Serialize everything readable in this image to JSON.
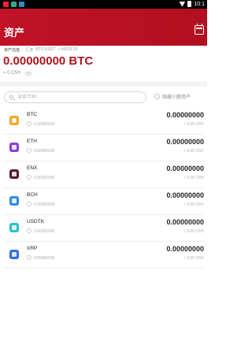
{
  "statusbar": {
    "time": "10:1"
  },
  "header": {
    "title": "资产"
  },
  "overview": {
    "valuation_label": "资产估值",
    "exchange_label": "汇率",
    "pair_label": "BTC/USDT",
    "pair_price": "≈ 44229.23",
    "total": "0.00000000 BTC",
    "total_cny": "≈ 0 CNY"
  },
  "search": {
    "placeholder": "搜索币种",
    "value": ""
  },
  "filter": {
    "hide_small_label": "隐藏小额资产"
  },
  "assets": [
    {
      "symbol": "BTC",
      "frozen": "0.00000000",
      "amount": "0.00000000",
      "cny": "≈ 0.00 CNY",
      "color": "#f5a623"
    },
    {
      "symbol": "ETH",
      "frozen": "0.00000000",
      "amount": "0.00000000",
      "cny": "≈ 0.00 CNY",
      "color": "#8b3fd9"
    },
    {
      "symbol": "ENX",
      "frozen": "0.00000000",
      "amount": "0.00000000",
      "cny": "≈ 0.00 CNY",
      "color": "#5a1a2a"
    },
    {
      "symbol": "BCH",
      "frozen": "0.00000000",
      "amount": "0.00000000",
      "cny": "≈ 0.00 CNY",
      "color": "#2f8de4"
    },
    {
      "symbol": "USDTK",
      "frozen": "0.00000000",
      "amount": "0.00000000",
      "cny": "≈ 0.00 CNY",
      "color": "#2cc2c9"
    },
    {
      "symbol": "XRP",
      "frozen": "0.00000000",
      "amount": "0.00000000",
      "cny": "≈ 0.00 CNY",
      "color": "#2f6fe4"
    }
  ]
}
